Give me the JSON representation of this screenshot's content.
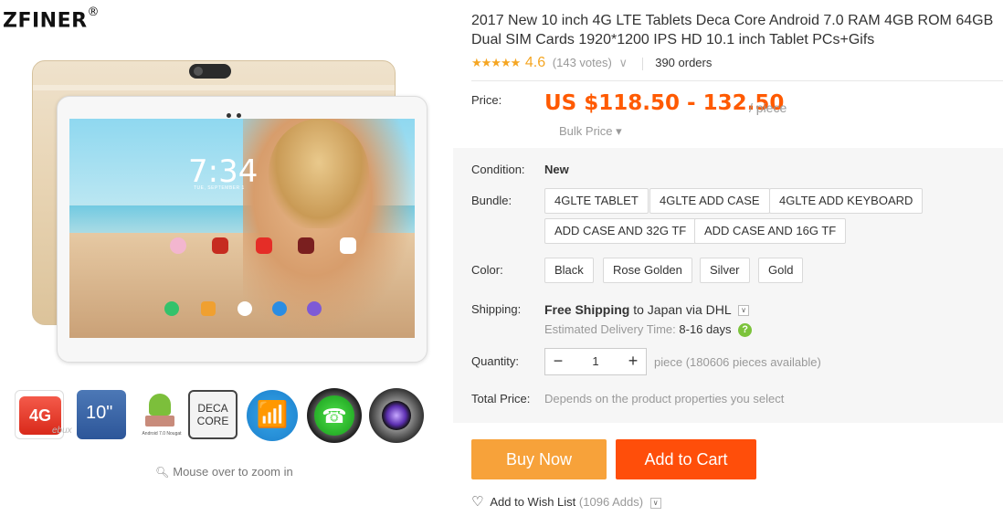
{
  "store": {
    "brand": "ZFINER",
    "registered": "®"
  },
  "gallery": {
    "screen_time": "7:34",
    "screen_date": "TUE, SEPTEMBER 1",
    "thumbs": {
      "t4g": "4G",
      "t4g_wm": "ebux",
      "t10": "10\"",
      "android_label": "Android 7.0 Nougat",
      "deca_line1": "DECA",
      "deca_line2": "CORE"
    },
    "zoom_hint": "Mouse over to zoom in"
  },
  "product": {
    "title": "2017 New 10 inch 4G LTE Tablets Deca Core Android 7.0 RAM 4GB ROM 64GB Dual SIM Cards 1920*1200 IPS HD 10.1 inch Tablet PCs+Gifs",
    "rating": {
      "stars": "★★★★★",
      "value": "4.6",
      "votes": "(143 votes)",
      "orders": "390 orders"
    },
    "price": {
      "label": "Price:",
      "range": "US $118.50 - 132.50",
      "unit": "/ piece",
      "bulk": "Bulk Price ▾"
    },
    "condition": {
      "label": "Condition:",
      "value": "New"
    },
    "bundle": {
      "label": "Bundle:",
      "options": [
        "4GLTE TABLET",
        "4GLTE ADD CASE",
        "4GLTE ADD KEYBOARD",
        "ADD CASE AND 32G TF",
        "ADD CASE AND 16G TF"
      ]
    },
    "color": {
      "label": "Color:",
      "options": [
        "Black",
        "Rose Golden",
        "Silver",
        "Gold"
      ]
    },
    "shipping": {
      "label": "Shipping:",
      "free": "Free Shipping",
      "to": "to Japan via DHL",
      "estimate_label": "Estimated Delivery Time:",
      "estimate_days": "8-16 days"
    },
    "quantity": {
      "label": "Quantity:",
      "value": "1",
      "note": "piece (180606 pieces available)"
    },
    "total": {
      "label": "Total Price:",
      "note": "Depends on the product properties you select"
    },
    "actions": {
      "buy_now": "Buy Now",
      "add_to_cart": "Add to Cart",
      "wishlist": "Add to Wish List",
      "wishlist_adds": "(1096 Adds)"
    }
  },
  "colors": {
    "price_orange": "#ff5a00",
    "buy_now": "#f7a23a",
    "add_to_cart": "#ff4e0a",
    "star": "#f5a623",
    "help_green": "#7cc33b"
  }
}
